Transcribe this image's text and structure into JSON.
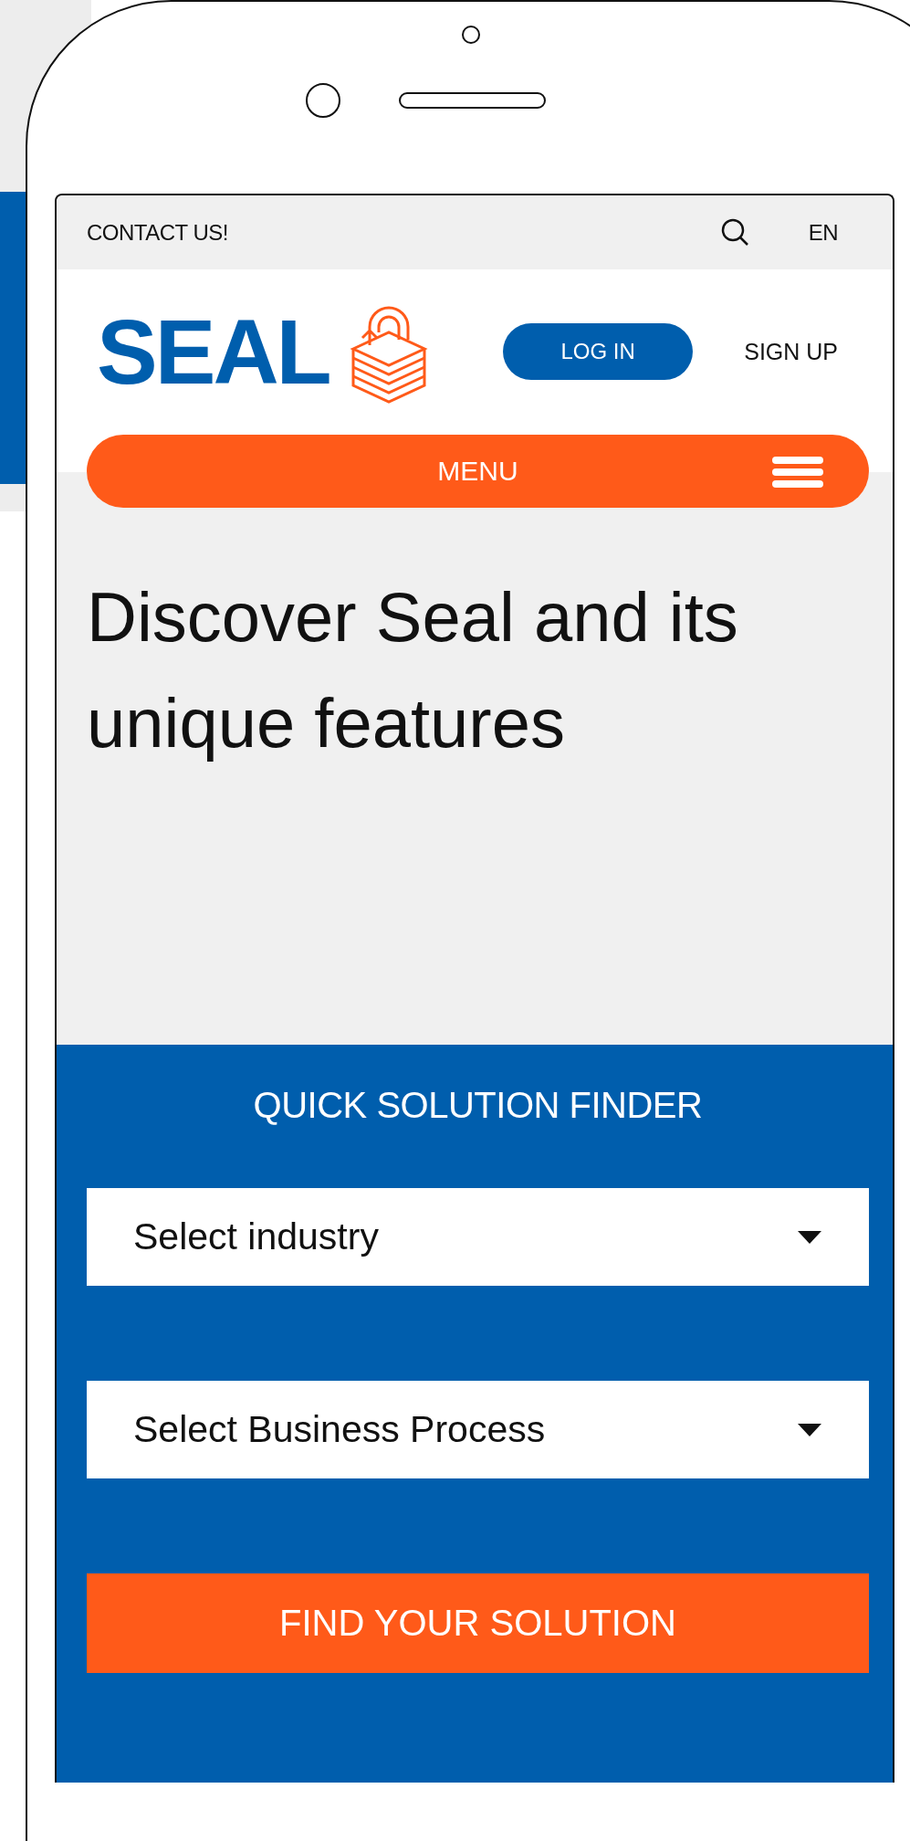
{
  "top_bar": {
    "contact_link": "CONTACT US!",
    "language": "EN"
  },
  "header": {
    "logo_text": "SEAL",
    "login_button": "LOG IN",
    "signup_link": "SIGN UP"
  },
  "menu": {
    "label": "MENU"
  },
  "hero": {
    "heading": "Discover Seal and its unique features"
  },
  "finder": {
    "title": "QUICK SOLUTION FINDER",
    "selects": [
      {
        "label": "Select industry"
      },
      {
        "label": "Select Business Process"
      }
    ],
    "button": "FIND YOUR SOLUTION"
  }
}
